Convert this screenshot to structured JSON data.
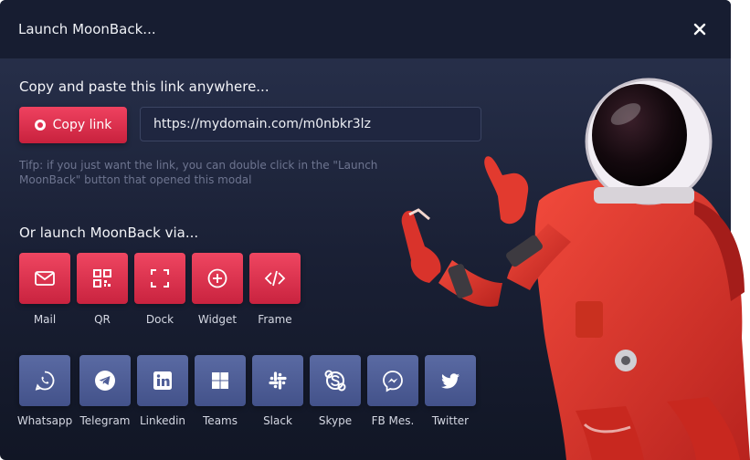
{
  "modal": {
    "title": "Launch MoonBack...",
    "close_icon": "close-icon"
  },
  "link_section": {
    "heading": "Copy and paste this link anywhere...",
    "copy_button_label": "Copy link",
    "link_value": "https://mydomain.com/m0nbkr3lz",
    "tip": "Tifp: if you just want the link, you can double click in the \"Launch MoonBack\" button that opened this modal"
  },
  "launch_section": {
    "heading": "Or launch MoonBack via...",
    "primary_options": [
      {
        "label": "Mail",
        "icon": "mail-icon"
      },
      {
        "label": "QR",
        "icon": "qr-code-icon"
      },
      {
        "label": "Dock",
        "icon": "dock-icon"
      },
      {
        "label": "Widget",
        "icon": "widget-icon"
      },
      {
        "label": "Frame",
        "icon": "code-icon"
      }
    ],
    "social_options": [
      {
        "label": "Whatsapp",
        "icon": "whatsapp-icon"
      },
      {
        "label": "Telegram",
        "icon": "telegram-icon"
      },
      {
        "label": "Linkedin",
        "icon": "linkedin-icon"
      },
      {
        "label": "Teams",
        "icon": "teams-icon"
      },
      {
        "label": "Slack",
        "icon": "slack-icon"
      },
      {
        "label": "Skype",
        "icon": "skype-icon"
      },
      {
        "label": "FB Mes.",
        "icon": "messenger-icon"
      },
      {
        "label": "Twitter",
        "icon": "twitter-icon"
      }
    ]
  },
  "colors": {
    "accent": "#e33552",
    "social_tile": "#4f5e98",
    "background": "#1b2135"
  }
}
